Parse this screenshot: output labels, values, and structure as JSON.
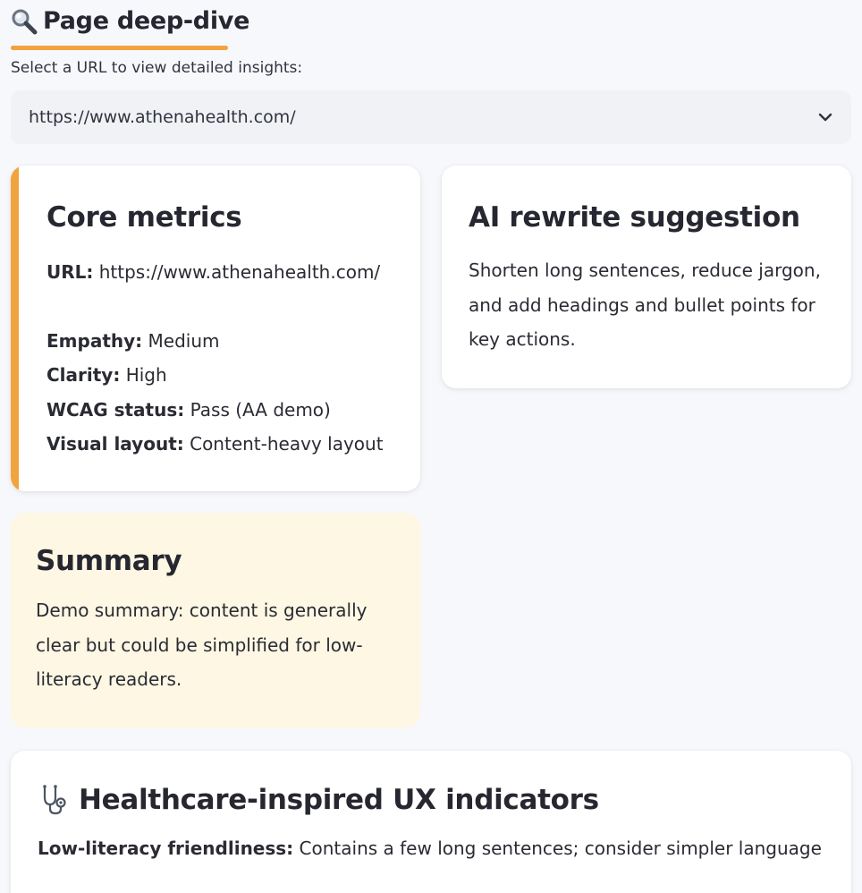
{
  "header": {
    "icon": "magnifier-icon",
    "title": "Page deep-dive",
    "accent_color": "#f0a33f"
  },
  "selector": {
    "label": "Select a URL to view detailed insights:",
    "selected": "https://www.athenahealth.com/",
    "icon": "chevron-down-icon"
  },
  "core_metrics": {
    "title": "Core metrics",
    "url_label": "URL:",
    "url_value": "https://www.athenahealth.com/",
    "empathy_label": "Empathy:",
    "empathy_value": "Medium",
    "clarity_label": "Clarity:",
    "clarity_value": "High",
    "wcag_label": "WCAG status:",
    "wcag_value": "Pass (AA demo)",
    "layout_label": "Visual layout:",
    "layout_value": "Content-heavy layout"
  },
  "ai_rewrite": {
    "title": "AI rewrite suggestion",
    "text": "Shorten long sentences, reduce jargon, and add headings and bullet points for key actions."
  },
  "summary": {
    "title": "Summary",
    "text": "Demo summary: content is generally clear but could be simplified for low-literacy readers."
  },
  "ux_indicators": {
    "icon": "stethoscope-icon",
    "title": "Healthcare-inspired UX indicators",
    "low_literacy_label": "Low-literacy friendliness:",
    "low_literacy_value": "Contains a few long sentences; consider simpler language"
  }
}
